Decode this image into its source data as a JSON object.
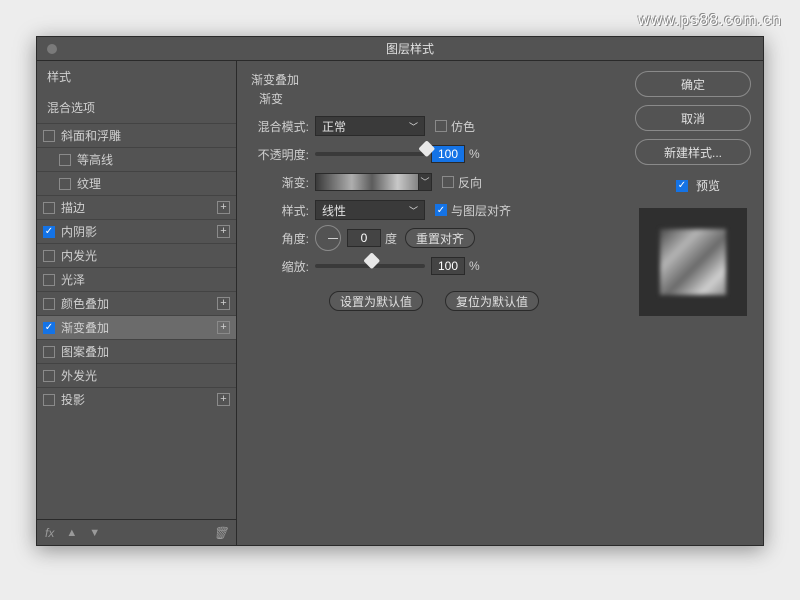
{
  "watermark": "www.ps88.com.cn",
  "dialog": {
    "title": "图层样式"
  },
  "sidebar": {
    "heading_styles": "样式",
    "heading_blend": "混合选项",
    "items": [
      {
        "label": "斜面和浮雕",
        "checked": false,
        "indent": false,
        "plus": false
      },
      {
        "label": "等高线",
        "checked": false,
        "indent": true,
        "plus": false
      },
      {
        "label": "纹理",
        "checked": false,
        "indent": true,
        "plus": false
      },
      {
        "label": "描边",
        "checked": false,
        "indent": false,
        "plus": true
      },
      {
        "label": "内阴影",
        "checked": true,
        "indent": false,
        "plus": true
      },
      {
        "label": "内发光",
        "checked": false,
        "indent": false,
        "plus": false
      },
      {
        "label": "光泽",
        "checked": false,
        "indent": false,
        "plus": false
      },
      {
        "label": "颜色叠加",
        "checked": false,
        "indent": false,
        "plus": true
      },
      {
        "label": "渐变叠加",
        "checked": true,
        "indent": false,
        "plus": true,
        "selected": true
      },
      {
        "label": "图案叠加",
        "checked": false,
        "indent": false,
        "plus": false
      },
      {
        "label": "外发光",
        "checked": false,
        "indent": false,
        "plus": false
      },
      {
        "label": "投影",
        "checked": false,
        "indent": false,
        "plus": true
      }
    ],
    "footer": {
      "fx": "fx",
      "up": "▲",
      "down": "▼",
      "trash": "🗑"
    }
  },
  "panel": {
    "title": "渐变叠加",
    "subtitle": "渐变",
    "blend_mode_label": "混合模式:",
    "blend_mode_value": "正常",
    "dither_label": "仿色",
    "opacity_label": "不透明度:",
    "opacity_value": "100",
    "percent": "%",
    "gradient_label": "渐变:",
    "reverse_label": "反向",
    "style_label": "样式:",
    "style_value": "线性",
    "align_label": "与图层对齐",
    "angle_label": "角度:",
    "angle_value": "0",
    "degree": "度",
    "reset_align": "重置对齐",
    "scale_label": "缩放:",
    "scale_value": "100",
    "make_default": "设置为默认值",
    "reset_default": "复位为默认值"
  },
  "buttons": {
    "ok": "确定",
    "cancel": "取消",
    "new_style": "新建样式...",
    "preview": "预览"
  }
}
